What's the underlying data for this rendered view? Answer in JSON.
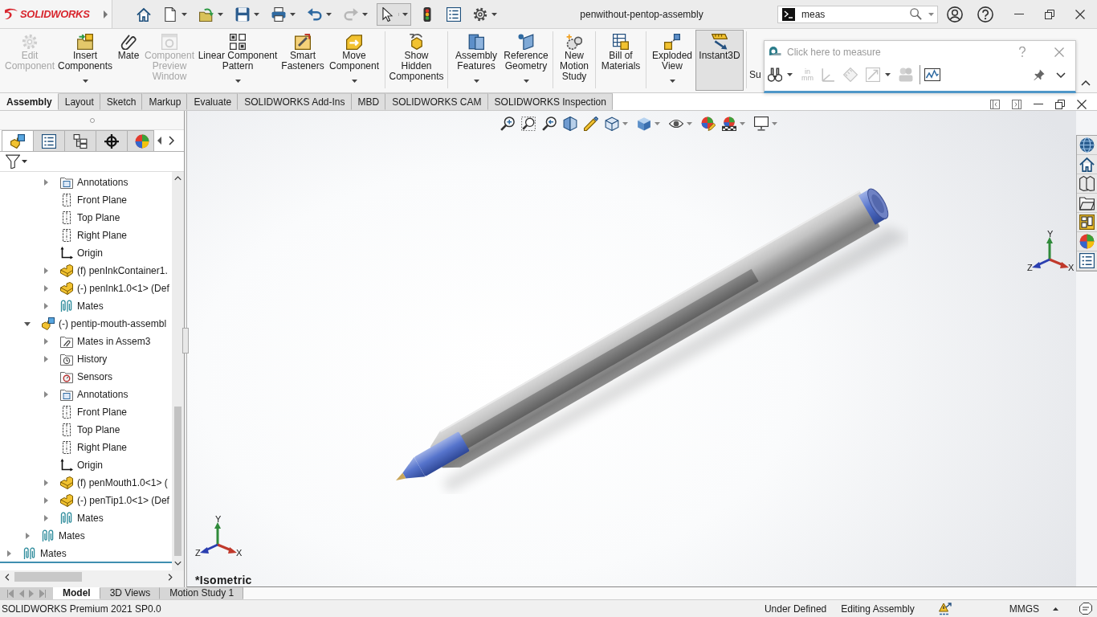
{
  "title_bar": {
    "logo": "SOLIDWORKS",
    "title": "penwithout-pentop-assembly",
    "search": {
      "value": "meas"
    }
  },
  "quick_access": [
    {
      "dropdown": false,
      "disabled": false,
      "pressed": false
    },
    {
      "dropdown": true,
      "disabled": false,
      "pressed": false
    },
    {
      "dropdown": true,
      "disabled": false,
      "pressed": false
    },
    {
      "dropdown": true,
      "disabled": false,
      "pressed": false
    },
    {
      "dropdown": true,
      "disabled": false,
      "pressed": false
    },
    {
      "dropdown": true,
      "disabled": false,
      "pressed": false
    },
    {
      "dropdown": true,
      "disabled": true,
      "pressed": false
    },
    {
      "dropdown": true,
      "disabled": false,
      "pressed": true
    },
    {
      "dropdown": false,
      "disabled": false,
      "pressed": false
    },
    {
      "dropdown": false,
      "disabled": false,
      "pressed": false
    },
    {
      "dropdown": true,
      "disabled": false,
      "pressed": false
    }
  ],
  "ribbon": {
    "groups": [
      [
        {
          "label": "Edit Component",
          "disabled": true,
          "pressed": false,
          "dropdown": false
        },
        {
          "label": "Insert Components",
          "disabled": false,
          "pressed": false,
          "dropdown": true
        },
        {
          "label": "Mate",
          "disabled": false,
          "pressed": false,
          "dropdown": false
        },
        {
          "label": "Component Preview Window",
          "disabled": true,
          "pressed": false,
          "dropdown": false
        },
        {
          "label": "Linear Component Pattern",
          "disabled": false,
          "pressed": false,
          "dropdown": true
        },
        {
          "label": "Smart Fasteners",
          "disabled": false,
          "pressed": false,
          "dropdown": false
        },
        {
          "label": "Move Component",
          "disabled": false,
          "pressed": false,
          "dropdown": true
        }
      ],
      [
        {
          "label": "Show Hidden Components",
          "disabled": false,
          "pressed": false,
          "dropdown": false
        }
      ],
      [
        {
          "label": "Assembly Features",
          "disabled": false,
          "pressed": false,
          "dropdown": true
        },
        {
          "label": "Reference Geometry",
          "disabled": false,
          "pressed": false,
          "dropdown": true
        }
      ],
      [
        {
          "label": "New Motion Study",
          "disabled": false,
          "pressed": false,
          "dropdown": false
        }
      ],
      [
        {
          "label": "Bill of Materials",
          "disabled": false,
          "pressed": false,
          "dropdown": false
        }
      ],
      [
        {
          "label": "Exploded View",
          "disabled": false,
          "pressed": false,
          "dropdown": true
        },
        {
          "label": "Instant3D",
          "disabled": false,
          "pressed": true,
          "dropdown": false
        }
      ]
    ],
    "cut_label": "Su"
  },
  "measure_popup": {
    "title": "Click here to measure",
    "tools": [
      {
        "kind": "icon",
        "disabled": false,
        "dropdown": true
      },
      {
        "kind": "units",
        "labels": [
          "in",
          "mm"
        ],
        "disabled": true,
        "dropdown": false
      },
      {
        "kind": "icon",
        "disabled": true,
        "dropdown": false
      },
      {
        "kind": "icon",
        "disabled": true,
        "dropdown": false
      },
      {
        "kind": "icon",
        "disabled": true,
        "dropdown": true
      },
      {
        "kind": "icon",
        "disabled": true,
        "dropdown": false
      },
      {
        "kind": "icon",
        "disabled": false,
        "dropdown": false
      }
    ]
  },
  "tabs": [
    {
      "label": "Assembly",
      "selected": true
    },
    {
      "label": "Layout",
      "selected": false
    },
    {
      "label": "Sketch",
      "selected": false
    },
    {
      "label": "Markup",
      "selected": false
    },
    {
      "label": "Evaluate",
      "selected": false
    },
    {
      "label": "SOLIDWORKS Add-Ins",
      "selected": false
    },
    {
      "label": "MBD",
      "selected": false
    },
    {
      "label": "SOLIDWORKS CAM",
      "selected": false
    },
    {
      "label": "SOLIDWORKS Inspection",
      "selected": false
    }
  ],
  "feature_tree": {
    "panel_tabs": [
      {
        "selected": true
      },
      {
        "selected": false
      },
      {
        "selected": false
      },
      {
        "selected": false
      },
      {
        "selected": false
      }
    ],
    "items": [
      {
        "children": [
          {
            "children": [
              {
                "label": "Annotations",
                "kind": "annotations",
                "expanded": false
              },
              {
                "label": "Front Plane",
                "kind": "plane"
              },
              {
                "label": "Top Plane",
                "kind": "plane"
              },
              {
                "label": "Right Plane",
                "kind": "plane"
              },
              {
                "label": "Origin",
                "kind": "origin"
              },
              {
                "label": "(f) penInkContainer1.",
                "kind": "part",
                "expanded": false
              },
              {
                "label": "(-) penInk1.0<1> (Def",
                "kind": "part",
                "expanded": false
              },
              {
                "label": "Mates",
                "kind": "mates",
                "expanded": false
              }
            ]
          },
          {
            "label": "(-) pentip-mouth-assembl",
            "kind": "assembly",
            "expanded": true,
            "children": [
              {
                "label": "Mates in Assem3",
                "kind": "mates-folder",
                "expanded": false
              },
              {
                "label": "History",
                "kind": "history",
                "expanded": false
              },
              {
                "label": "Sensors",
                "kind": "sensors"
              },
              {
                "label": "Annotations",
                "kind": "annotations",
                "expanded": false
              },
              {
                "label": "Front Plane",
                "kind": "plane"
              },
              {
                "label": "Top Plane",
                "kind": "plane"
              },
              {
                "label": "Right Plane",
                "kind": "plane"
              },
              {
                "label": "Origin",
                "kind": "origin"
              },
              {
                "label": "(f) penMouth1.0<1> (",
                "kind": "part",
                "expanded": false
              },
              {
                "label": "(-) penTip1.0<1> (Def",
                "kind": "part",
                "expanded": false
              },
              {
                "label": "Mates",
                "kind": "mates",
                "expanded": false
              }
            ]
          },
          {
            "label": "Mates",
            "kind": "mates",
            "expanded": false
          }
        ]
      },
      {
        "label": "Mates",
        "kind": "mates",
        "expanded": false
      }
    ]
  },
  "viewport": {
    "triads": [
      {
        "y": "Y",
        "z": "Z",
        "x": "X"
      },
      {
        "y": "Y",
        "z": "Z",
        "x": "X"
      }
    ],
    "view_name": "*Isometric"
  },
  "bottom_tabs": [
    {
      "label": "Model",
      "selected": true
    },
    {
      "label": "3D Views",
      "selected": false
    },
    {
      "label": "Motion Study 1",
      "selected": false
    }
  ],
  "status_bar": {
    "product": "SOLIDWORKS Premium 2021 SP0.0",
    "state": "Under Defined",
    "mode": "Editing Assembly",
    "units": "MMGS"
  }
}
